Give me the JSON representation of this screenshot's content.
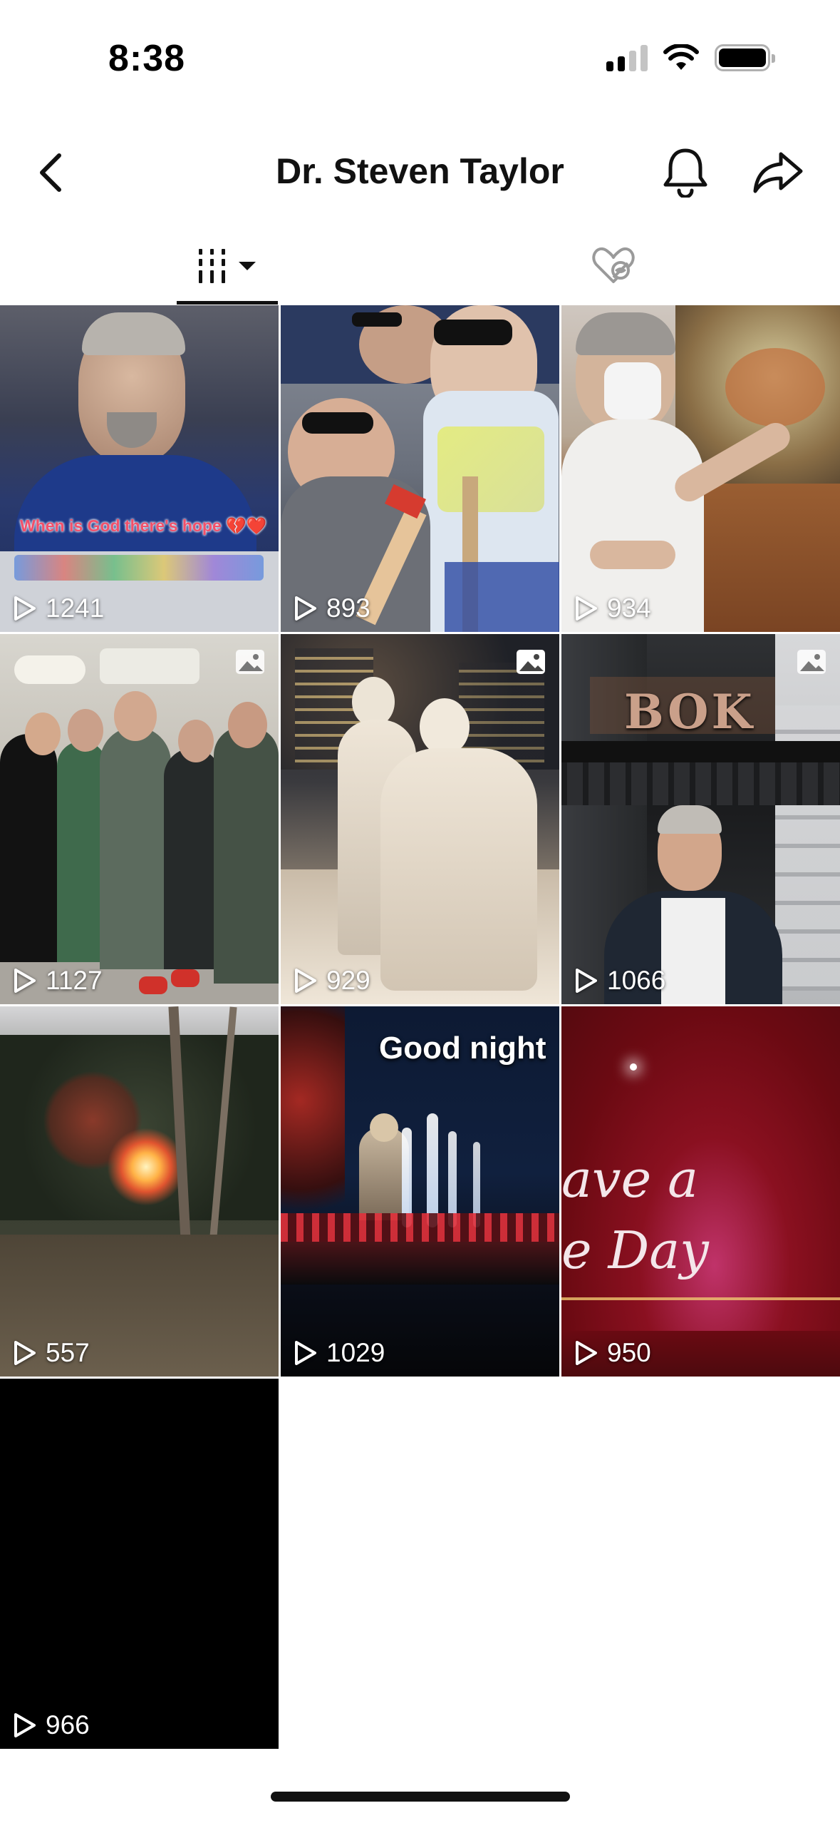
{
  "status_bar": {
    "time": "8:38"
  },
  "header": {
    "title": "Dr. Steven Taylor"
  },
  "videos": [
    {
      "views": "1241",
      "caption": "When is God there's hope 💔❤️",
      "photo": false
    },
    {
      "views": "893",
      "photo": false
    },
    {
      "views": "934",
      "photo": false
    },
    {
      "views": "1127",
      "photo": true
    },
    {
      "views": "929",
      "photo": true
    },
    {
      "views": "1066",
      "caption": "BOK",
      "photo": true
    },
    {
      "views": "557",
      "photo": false
    },
    {
      "views": "1029",
      "caption": "Good night",
      "photo": false
    },
    {
      "views": "950",
      "caption_line1": "ave a",
      "caption_line2": "e Day",
      "photo": false
    },
    {
      "views": "966",
      "photo": false
    }
  ],
  "icons": {
    "back": "chevron-left-icon",
    "bell": "bell-icon",
    "share": "share-arrow-icon",
    "videos_tab": "grid-bars-icon",
    "liked_tab": "heart-hidden-icon",
    "play": "play-icon",
    "photo": "photo-icon"
  },
  "colors": {
    "accent": "#111111",
    "background": "#ffffff",
    "tab_inactive": "#9a9a9a"
  }
}
